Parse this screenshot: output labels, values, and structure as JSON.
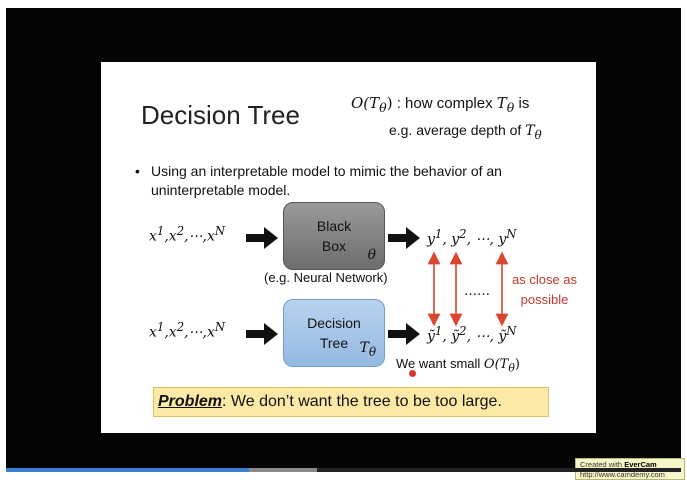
{
  "video": {
    "progress_fraction": 0.36,
    "buffered_fraction": 0.46
  },
  "slide": {
    "title": "Decision Tree",
    "complexity_note": {
      "symbol": "O(T",
      "subscript": "θ",
      "close": ")",
      "text": ": how complex ",
      "t_symbol": "T",
      "t_sub": "θ",
      "tail": " is"
    },
    "depth_note": {
      "text": "e.g. average depth of ",
      "t_symbol": "T",
      "t_sub": "θ"
    },
    "bullet": "Using an interpretable model to mimic the behavior of an uninterpretable model.",
    "input_sequence": {
      "x": "x",
      "s1": "1",
      "x2": ",x",
      "s2": "2",
      "sep": ",⋯,x",
      "sn": "N"
    },
    "black_box": {
      "line1": "Black",
      "line2": "Box",
      "symbol": "θ"
    },
    "nn_label": "(e.g. Neural Network)",
    "output_sequence": {
      "y": "y",
      "s1": "1",
      "y2": ", y",
      "s2": "2",
      "sep": ", ⋯, y",
      "sn": "N"
    },
    "decision_tree": {
      "line1": "Decision",
      "line2": "Tree",
      "symbol": "T",
      "symbol_sub": "θ"
    },
    "tilde_sequence": {
      "y": "ỹ",
      "s1": "1",
      "y2": ", ỹ",
      "s2": "2",
      "sep": ", ⋯, ỹ",
      "sn": "N"
    },
    "dots": "……",
    "close_line1": "as close as",
    "close_line2": "possible",
    "want_small": "We want small ",
    "want_symbol": "O(T",
    "want_sub": "θ",
    "want_close": ")",
    "problem_key": "Problem",
    "problem_text": ": We don’t want the tree to be too large."
  },
  "watermark": {
    "prefix": "Created with ",
    "brand": "EverCam",
    "url": "http://www.camdemy.com"
  },
  "colors": {
    "accent_red": "#c0392b",
    "progress_blue": "#3a7fd5",
    "problem_highlight": "#fde9a6"
  }
}
